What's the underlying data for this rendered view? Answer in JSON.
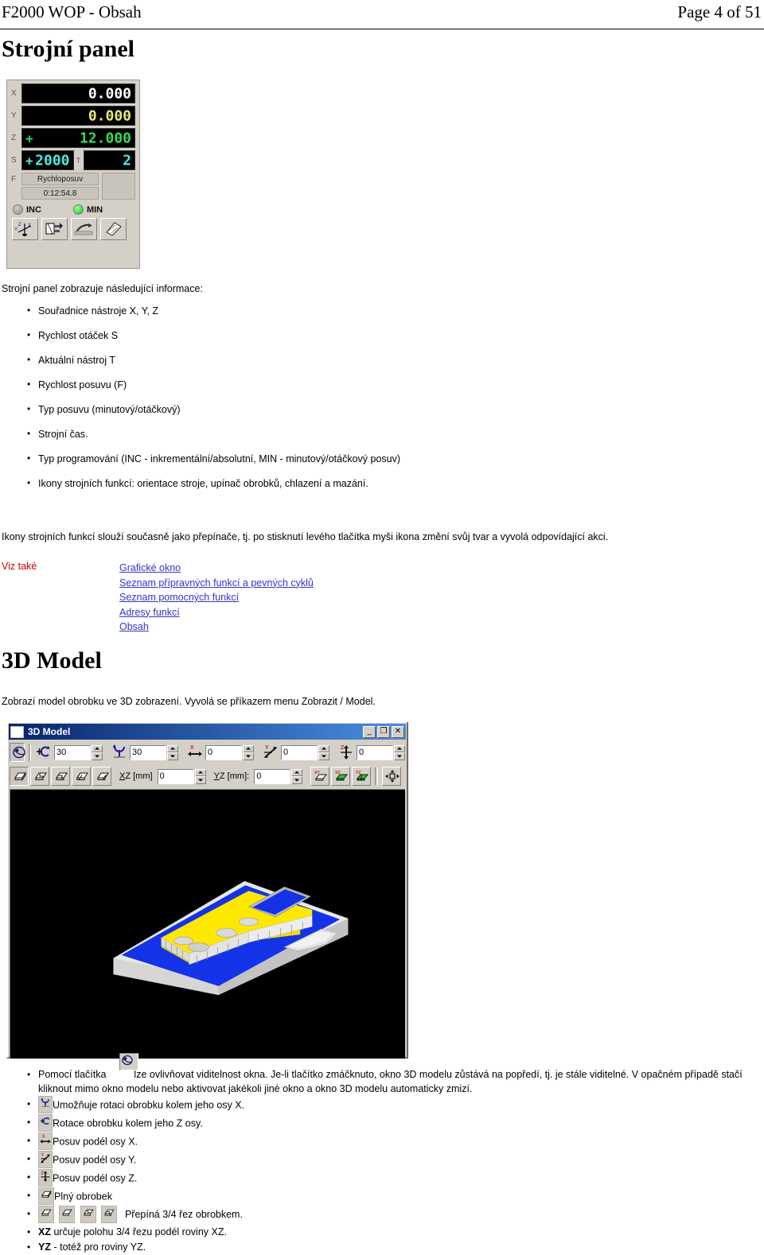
{
  "header": {
    "doc_title": "F2000 WOP - Obsah",
    "page_label": "Page 4 of 51"
  },
  "sections": {
    "machine_panel_title": "Strojní panel",
    "model_title": "3D Model",
    "intro_line": "Strojní panel zobrazuje následující informace:",
    "switch_note": "Ikony strojních funkcí slouží současně jako přepínače, tj. po stisknutí levého tlačítka myši ikona změní svůj tvar a vyvolá odpovídající akci.",
    "model_desc": "Zobrazí model obrobku ve 3D zobrazení. Vyvolá se příkazem menu Zobrazit / Model."
  },
  "machine_panel": {
    "axes": [
      {
        "label": "X",
        "sign": "",
        "value": "0.000"
      },
      {
        "label": "Y",
        "sign": "",
        "value": "0.000"
      },
      {
        "label": "Z",
        "sign": "+",
        "value": "12.000"
      }
    ],
    "spindle": {
      "label": "S",
      "sign": "+",
      "value": "2000"
    },
    "tool": {
      "label": "T",
      "value": "2"
    },
    "feed": {
      "label": "F",
      "value": "Rychloposuv"
    },
    "machine_time": "0:12:54.8",
    "indicators": [
      {
        "name": "INC",
        "state": "off"
      },
      {
        "name": "MIN",
        "state": "on"
      }
    ],
    "function_buttons": [
      "machine-orientation",
      "workpiece-clamp",
      "coolant",
      "lubrication"
    ]
  },
  "panel_info_items": [
    "Souřadnice nástroje X, Y, Z",
    "Rychlost otáček S",
    "Aktuální nástroj T",
    "Rychlost posuvu (F)",
    "Typ posuvu (minutový/otáčkový)",
    "Strojní čas.",
    "Typ programování (INC - inkrementální/absolutní, MIN - minutový/otáčkový posuv)",
    "Ikony strojních funkcí: orientace stroje, upínač obrobků, chlazení a mazání."
  ],
  "see_also": {
    "label": "Viz také",
    "links": [
      "Grafické okno",
      "Seznam přípravných funkcí a pevných cyklů",
      "Seznam pomocných funkcí",
      "Adresy funkcí",
      "Obsah"
    ],
    "link_color": "#3333cc",
    "label_color": "#cc0000"
  },
  "model_window": {
    "title": "3D Model",
    "window_buttons": [
      "minimize",
      "maximize",
      "close"
    ],
    "toolbar_row1": {
      "pin_button": "always-on-top",
      "fields": [
        {
          "icon": "rotate-z-icon",
          "value": "30"
        },
        {
          "icon": "rotate-x-icon",
          "value": "30"
        },
        {
          "icon": "pan-x-icon",
          "axis": "X",
          "value": "0"
        },
        {
          "icon": "pan-y-icon",
          "axis": "Y",
          "value": "0"
        },
        {
          "icon": "pan-z-icon",
          "axis": "Z",
          "value": "0"
        }
      ]
    },
    "toolbar_row2": {
      "view_buttons": [
        "full-workpiece",
        "cut-1",
        "cut-2",
        "cut-3",
        "cut-4"
      ],
      "xz_label": "XZ [mm]",
      "xz_value": "0",
      "yz_label": "YZ [mm]:",
      "yz_value": "0",
      "plane_buttons": [
        "xy-plane",
        "xz-plane",
        "yz-plane"
      ],
      "fit_button": "fit-to-window"
    },
    "viewport": {
      "background": "#000000",
      "workpiece_color": "#ffe800",
      "stock_color": "#1432e6",
      "base_color": "#e8e8e8",
      "pocket_color": "#1432e6"
    }
  },
  "notes": [
    {
      "id": "visibility",
      "icon": "pin-icon",
      "text_before": "Pomocí tlačítka",
      "text_after": "lze ovlivňovat viditelnost okna. Je-li tlačítko zmáčknuto, okno 3D modelu zůstává na popředí, tj. je stále viditelné. V opačném případě stačí kliknout mimo okno modelu nebo aktivovat jakékoli jiné okno a okno 3D modelu automaticky zmizí."
    },
    {
      "id": "rot-x",
      "icon": "rotate-x-icon",
      "text": "Umožňuje rotaci obrobku kolem jeho osy X."
    },
    {
      "id": "rot-z",
      "icon": "rotate-z-icon",
      "text": "Rotace obrobku kolem jeho Z osy."
    },
    {
      "id": "pan-x",
      "icon": "pan-x-icon",
      "text": "Posuv podél osy X."
    },
    {
      "id": "pan-y",
      "icon": "pan-y-icon",
      "text": "Posuv podél osy Y."
    },
    {
      "id": "pan-z",
      "icon": "pan-z-icon",
      "text": "Posuv podél osy Z."
    },
    {
      "id": "full",
      "icon": "full-workpiece-icon",
      "text": "Plný obrobek"
    },
    {
      "id": "cuts",
      "icon": "cut-icons",
      "text": "Přepíná 3/4 řez obrobkem."
    },
    {
      "id": "xz",
      "bold": "XZ",
      "text": " určuje polohu 3/4 řezu podél roviny XZ."
    },
    {
      "id": "yz",
      "bold": "YZ",
      "text": " - totéž pro roviny YZ."
    }
  ]
}
